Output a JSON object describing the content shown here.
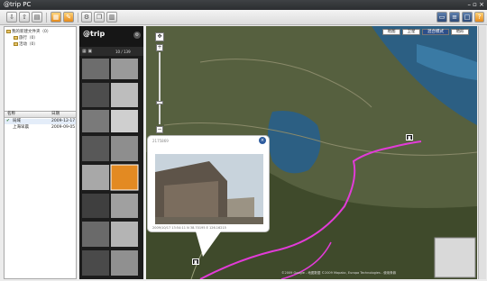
{
  "app": {
    "title": "@trip PC"
  },
  "colors": {
    "route": "#e23bd8",
    "titlebar": "#2f3134",
    "water": "#2c5f83"
  },
  "icons": [
    "app-icon",
    "import-icon",
    "export-icon",
    "folder-icon",
    "photo-icon",
    "edit-icon",
    "settings-icon",
    "window-icon",
    "map-icon",
    "grid-icon",
    "help-icon"
  ],
  "tree": {
    "root": "我的新建文件夹（0）",
    "children": [
      "旅行（0）",
      "活动（0）"
    ]
  },
  "list": {
    "headers": [
      "名称",
      "日期"
    ],
    "rows": [
      {
        "name": "局域",
        "date": "2009-12-17"
      },
      {
        "name": "上海早晨",
        "date": "2009-09-05"
      }
    ]
  },
  "strip": {
    "logo": "@trip",
    "counter": "10 / 139"
  },
  "map": {
    "types": [
      "地图",
      "卫星",
      "混合模式",
      "地形"
    ],
    "active_type": "混合模式",
    "popup": {
      "caption": "2009/10/17 13:54:11  N 38.70195  E 126.16215",
      "header": "2175869"
    },
    "copyright": "©2009 Google - 地图数据 ©2009 Mapabc, Europa Technologies - 使用条款"
  }
}
